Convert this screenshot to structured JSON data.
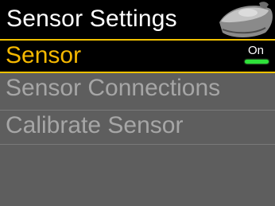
{
  "header": {
    "title": "Sensor Settings",
    "icon": "sensor-device-icon"
  },
  "menu": {
    "items": [
      {
        "label": "Sensor",
        "selected": true,
        "toggle": {
          "text": "On",
          "value": true
        }
      },
      {
        "label": "Sensor Connections",
        "selected": false
      },
      {
        "label": "Calibrate Sensor",
        "selected": false
      }
    ]
  },
  "colors": {
    "header_bg": "#000000",
    "selected_text": "#f5b800",
    "highlight_rule": "#f2c200",
    "normal_text": "#a6a6a6",
    "body_bg": "#5e5e5e",
    "toggle_on": "#2ee23a"
  }
}
